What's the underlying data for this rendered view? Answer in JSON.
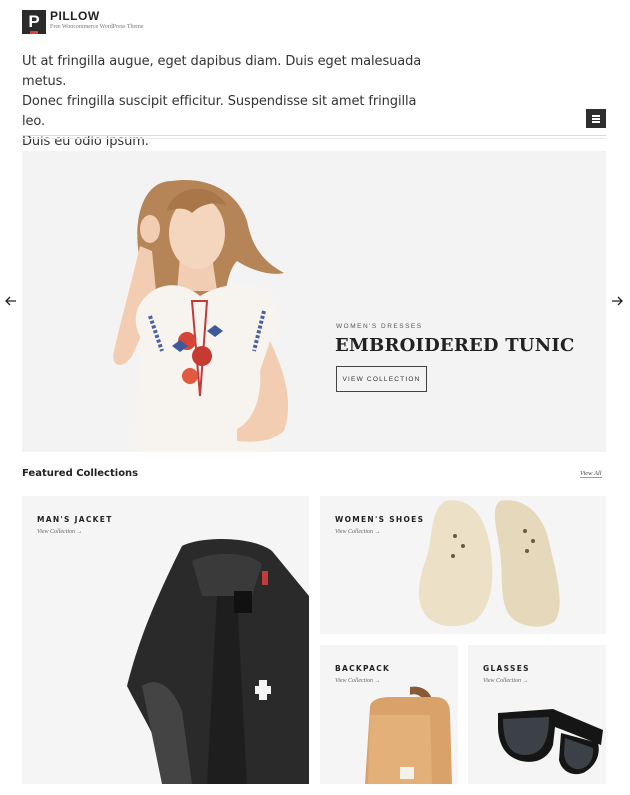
{
  "header": {
    "logo_letter": "P",
    "site_name": "PILLOW",
    "tagline": "Free Woocommerce WordPress Theme",
    "intro_lines": [
      "Ut at fringilla augue, eget dapibus diam. Duis eget malesuada metus.",
      "Donec fringilla suscipit efficitur. Suspendisse sit amet fringilla leo.",
      "Duis eu odio ipsum."
    ],
    "menu_icon": "hamburger-icon"
  },
  "hero": {
    "kicker": "WOMEN'S DRESSES",
    "title": "EMBROIDERED TUNIC",
    "button_label": "VIEW COLLECTION",
    "prev_icon": "arrow-left-icon",
    "next_icon": "arrow-right-icon"
  },
  "featured": {
    "heading": "Featured Collections",
    "view_all": "View All",
    "cards": [
      {
        "title": "MAN'S JACKET",
        "link": "View Collection →"
      },
      {
        "title": "WOMEN'S SHOES",
        "link": "View Collection →"
      },
      {
        "title": "BACKPACK",
        "link": "View Collection →"
      },
      {
        "title": "GLASSES",
        "link": "View Collection →"
      }
    ]
  },
  "colors": {
    "accent_red": "#e23b3b",
    "dark": "#2b2b2b",
    "panel": "#f3f3f3"
  }
}
